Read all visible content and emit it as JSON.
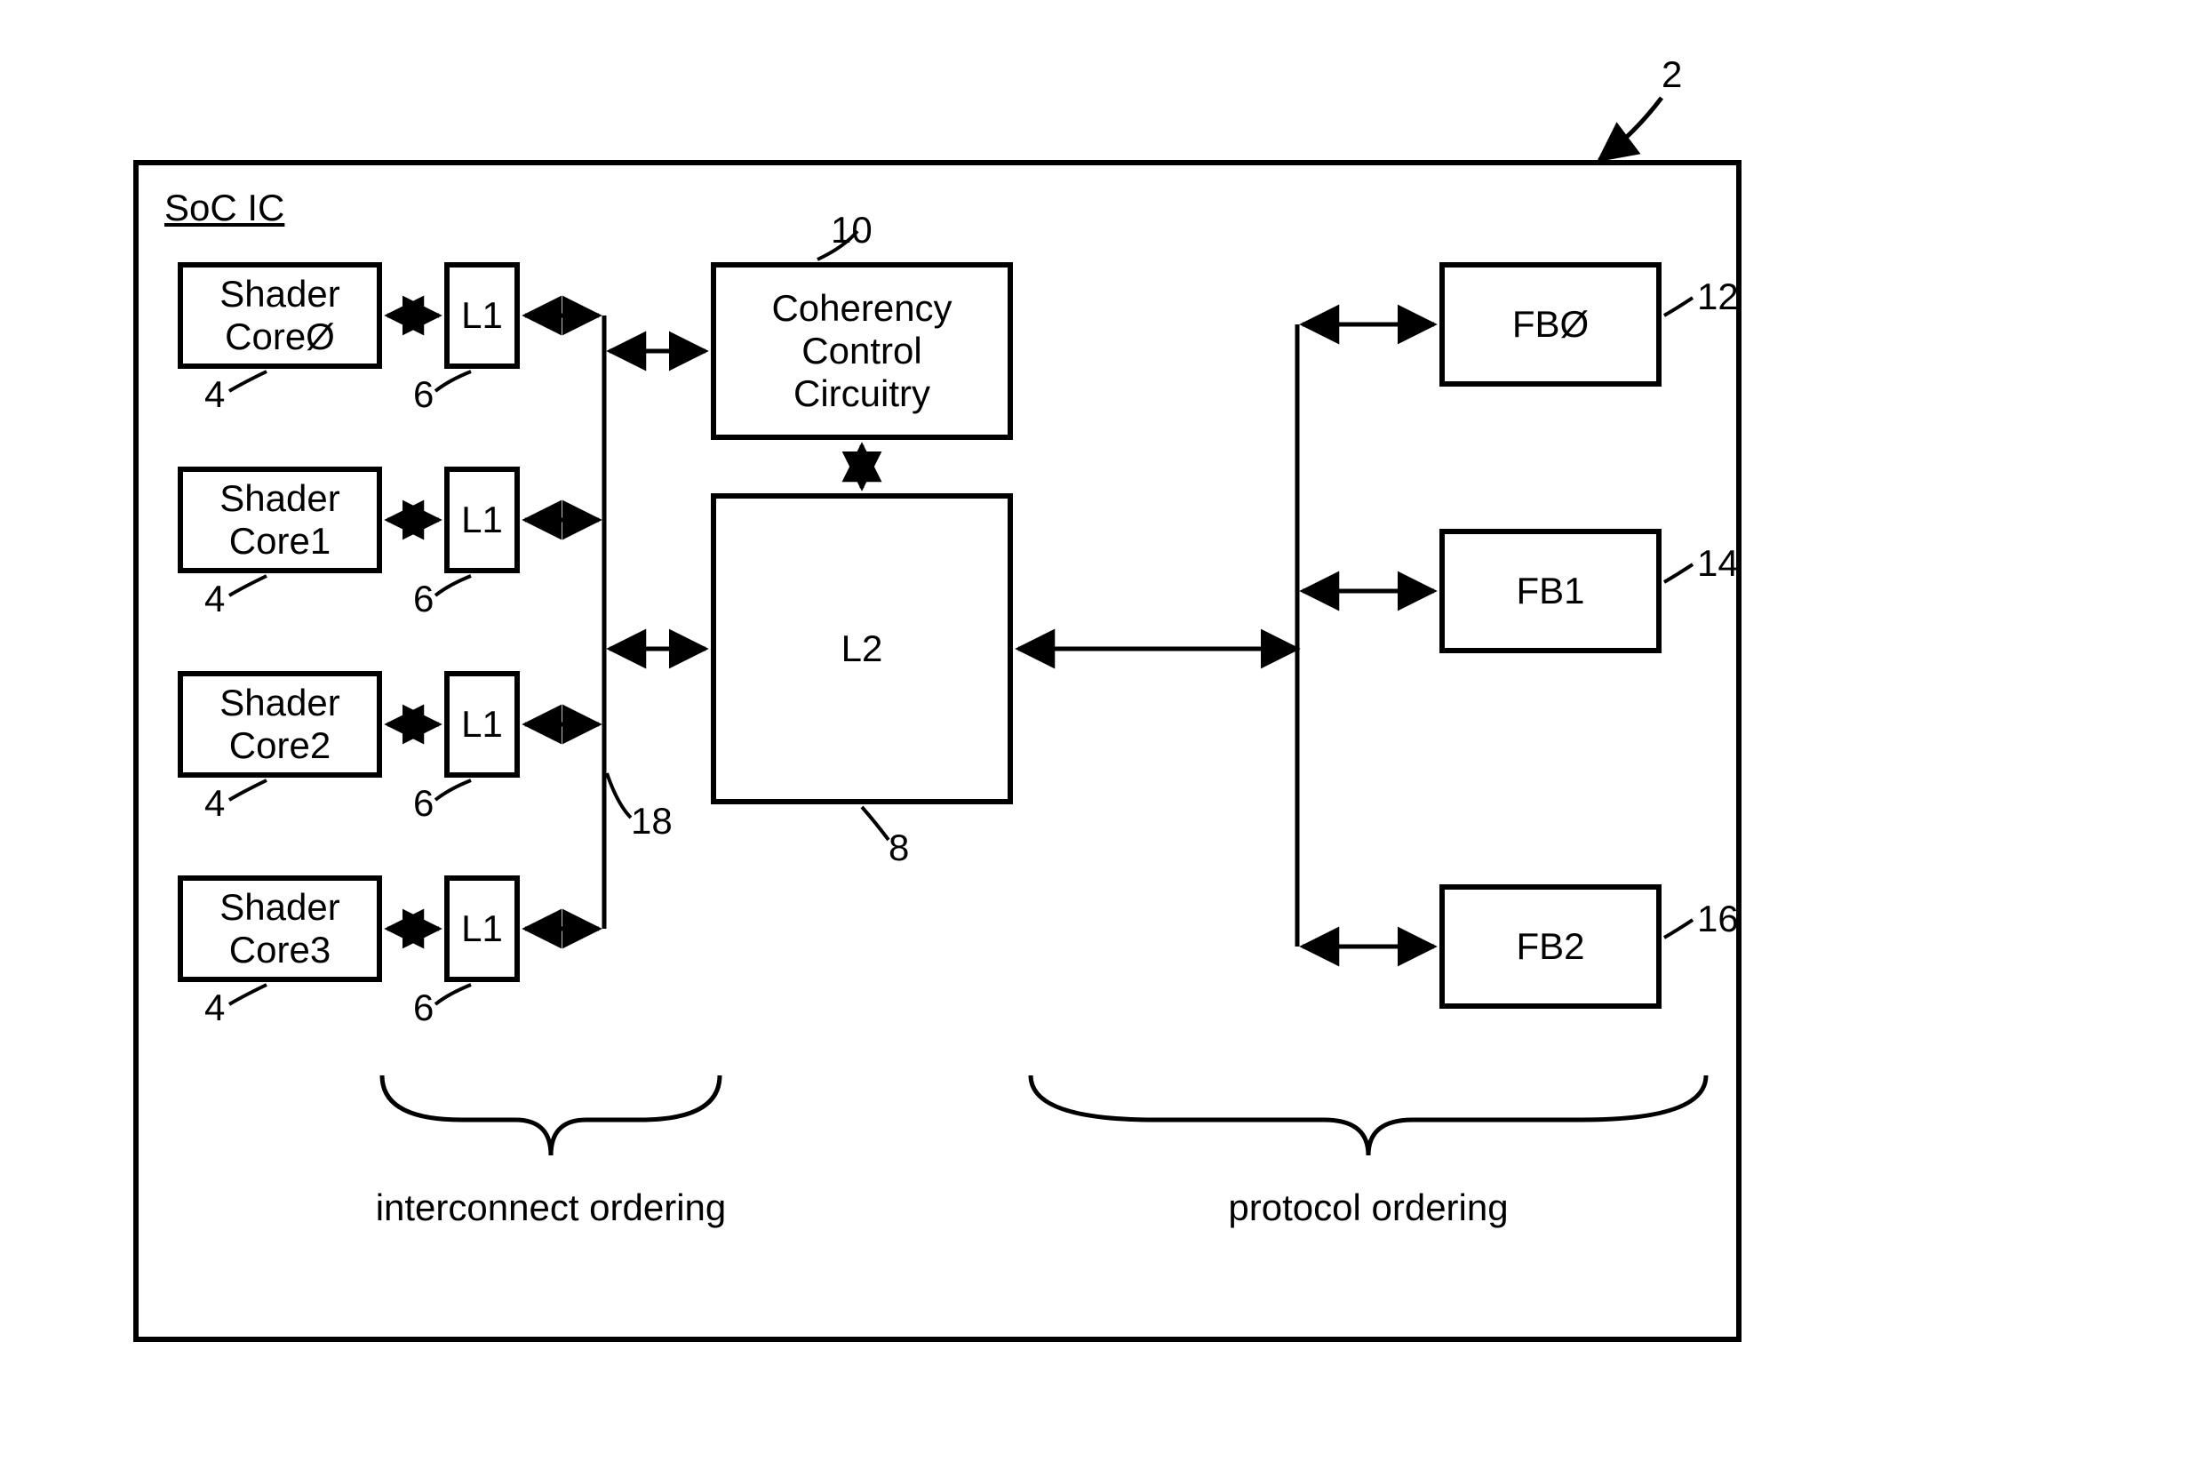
{
  "outer": {
    "title": "SoC IC",
    "ref": "2"
  },
  "shaders": [
    {
      "label": "Shader\nCoreØ",
      "ref": "4"
    },
    {
      "label": "Shader\nCore1",
      "ref": "4"
    },
    {
      "label": "Shader\nCore2",
      "ref": "4"
    },
    {
      "label": "Shader\nCore3",
      "ref": "4"
    }
  ],
  "l1": {
    "label": "L1",
    "ref": "6"
  },
  "coherency": {
    "label": "Coherency\nControl\nCircuitry",
    "ref": "10"
  },
  "l2": {
    "label": "L2",
    "ref": "8"
  },
  "bus_left_ref": "18",
  "fbs": [
    {
      "label": "FBØ",
      "ref": "12"
    },
    {
      "label": "FB1",
      "ref": "14"
    },
    {
      "label": "FB2",
      "ref": "16"
    }
  ],
  "braces": {
    "left": "interconnect ordering",
    "right": "protocol ordering"
  }
}
